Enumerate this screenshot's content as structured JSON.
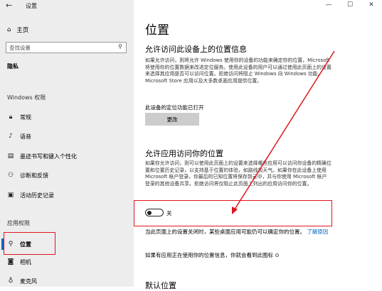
{
  "window": {
    "title": "设置",
    "minimize": "—",
    "maximize": "☐",
    "close": "✕"
  },
  "sidebar": {
    "home": "主页",
    "search_placeholder": "查找设置",
    "privacy_heading": "隐私",
    "windows_perm_heading": "Windows 权限",
    "windows_items": [
      {
        "label": "常规",
        "icon": "lock-icon"
      },
      {
        "label": "语音",
        "icon": "voice-icon"
      },
      {
        "label": "墨迹书写和键入个性化",
        "icon": "ink-icon"
      },
      {
        "label": "诊断和反馈",
        "icon": "feedback-icon"
      },
      {
        "label": "活动历史记录",
        "icon": "history-icon"
      }
    ],
    "app_perm_heading": "应用权限",
    "app_items": [
      {
        "label": "位置",
        "icon": "location-icon",
        "selected": true
      },
      {
        "label": "相机",
        "icon": "camera-icon"
      },
      {
        "label": "麦克风",
        "icon": "microphone-icon"
      }
    ]
  },
  "main": {
    "title": "位置",
    "device_section_title": "允许访问此设备上的位置信息",
    "device_section_text": "如果允许访问，则将允许 Windows 使用你的设备的功能来确定你的位置，Microsoft 将使用你的位置数据来改进定位服务。使用此设备的用户可以通过使用此页面上的设置来选择其应用是否可以访问位置。拒绝访问将阻止 Windows 向 Windows 功能、Microsoft Store 应用以及大多数桌面应用提供位置。",
    "device_status": "此设备的定位功能已打开",
    "change_button": "更改",
    "app_section_title": "允许应用访问你的位置",
    "app_section_text": "如果你允许访问，则可以使用此页面上的设置来选择哪些应用可以访问你设备的精确位置和位置历史记录，以支持基于位置的体验，如路线和天气。如果你在此设备上使用 Microsoft 帐户登录，你最后的已知位置将保存到云中，并与你使用 Microsoft 帐户登录的其他设备共享。拒绝访问将仅阻止此页面上列出的应用访问你的位置。",
    "toggle_state": "关",
    "toggle_on": false,
    "note_text": "当此页面上的设置关闭时，某些桌面应用可能仍可以确定你的位置。",
    "note_link": "了解原因",
    "icon_note": "如果有应用正在使用你的位置信息，你就会看到此图标",
    "icon_note_glyph": "⊙",
    "bottom_section_title": "默认位置"
  },
  "colors": {
    "accent": "#0067c0",
    "annotation_red": "#e0151f",
    "sidebar_bg": "#ededed"
  }
}
